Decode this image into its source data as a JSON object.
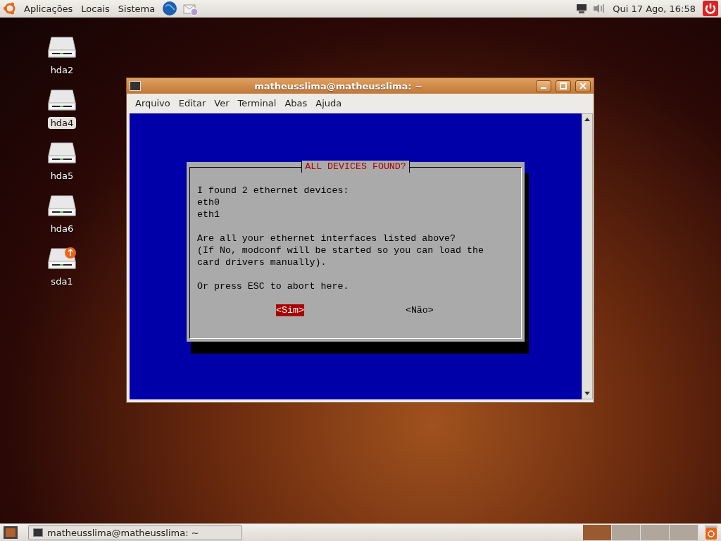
{
  "top_panel": {
    "menus": [
      "Aplicações",
      "Locais",
      "Sistema"
    ],
    "clock": "Qui 17 Ago, 16:58"
  },
  "desktop_icons": [
    {
      "label": "hda2",
      "selected": false,
      "kind": "drive"
    },
    {
      "label": "hda4",
      "selected": true,
      "kind": "drive"
    },
    {
      "label": "hda5",
      "selected": false,
      "kind": "drive"
    },
    {
      "label": "hda6",
      "selected": false,
      "kind": "drive"
    },
    {
      "label": "sda1",
      "selected": false,
      "kind": "usb"
    }
  ],
  "window": {
    "title": "matheusslima@matheusslima: ~",
    "menu": [
      "Arquivo",
      "Editar",
      "Ver",
      "Terminal",
      "Abas",
      "Ajuda"
    ]
  },
  "dialog": {
    "title": "ALL DEVICES FOUND?",
    "paragraphs": [
      [
        "I found 2 ethernet devices:",
        "eth0",
        "eth1"
      ],
      [
        "Are all your ethernet interfaces listed above?",
        "(If No, modconf will be started so you can load the",
        "card drivers manually)."
      ],
      [
        "Or press ESC to abort here."
      ]
    ],
    "buttons": [
      {
        "label": "<Sim>",
        "selected": true
      },
      {
        "label": "<Não>",
        "selected": false
      }
    ]
  },
  "taskbar": {
    "tasks": [
      "matheusslima@matheusslima: ~"
    ],
    "workspaces": [
      {
        "selected": true
      },
      {
        "selected": false
      },
      {
        "selected": false
      },
      {
        "selected": false
      }
    ]
  }
}
